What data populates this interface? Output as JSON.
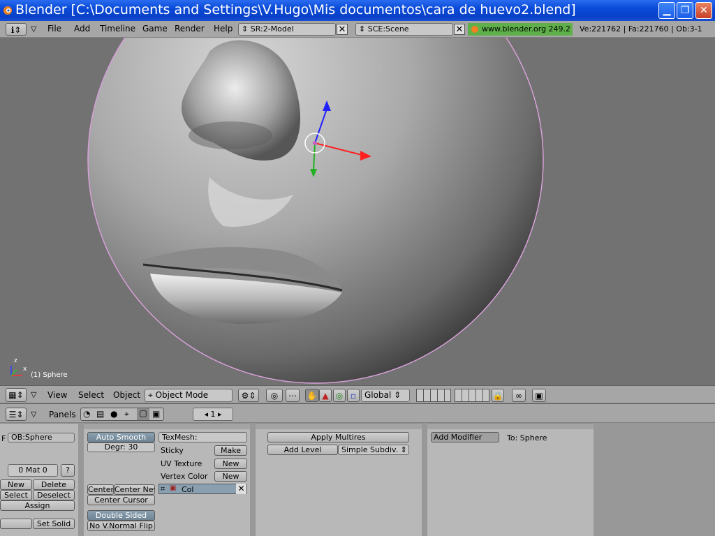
{
  "window": {
    "title": "Blender [C:\\Documents and Settings\\V.Hugo\\Mis documentos\\cara de huevo2.blend]"
  },
  "top_header": {
    "menus": [
      "File",
      "Add",
      "Timeline",
      "Game",
      "Render",
      "Help"
    ],
    "screen": "SR:2-Model",
    "scene": "SCE:Scene",
    "website": "www.blender.org 249.2",
    "stats": "Ve:221762 | Fa:221760 | Ob:3-1"
  },
  "viewport": {
    "object_label": "(1) Sphere",
    "axis_z": "z",
    "axis_x": "x",
    "bg_color": "#727272"
  },
  "view3d_header": {
    "menus": [
      "View",
      "Select",
      "Object"
    ],
    "mode": "Object Mode",
    "orientation": "Global"
  },
  "buttons_header": {
    "panels_label": "Panels",
    "frame": "1"
  },
  "link_panel": {
    "ob_field": "OB:Sphere",
    "mat_field": "0 Mat 0",
    "question": "?",
    "new": "New",
    "delete": "Delete",
    "select": "Select",
    "deselect": "Deselect",
    "assign": "Assign",
    "set_solid": "Set Solid",
    "f_label": "F"
  },
  "mesh_panel": {
    "auto_smooth": "Auto Smooth",
    "degr": "Degr: 30",
    "center": "Center",
    "center_new": "Center New",
    "center_cursor": "Center Cursor",
    "double_sided": "Double Sided",
    "no_vnormal_flip": "No V.Normal Flip",
    "texmesh": "TexMesh:",
    "sticky": "Sticky",
    "make": "Make",
    "uv_texture": "UV Texture",
    "uv_new": "New",
    "vertex_color": "Vertex Color",
    "vc_new": "New",
    "col": "Col"
  },
  "multires_panel": {
    "apply": "Apply Multires",
    "add_level": "Add Level",
    "subdiv": "Simple Subdiv."
  },
  "modifiers_panel": {
    "add_modifier": "Add Modifier",
    "to": "To: Sphere"
  }
}
